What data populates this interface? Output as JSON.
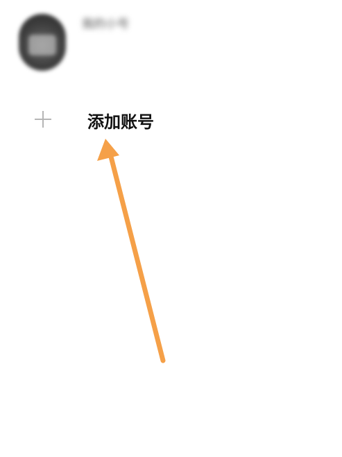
{
  "account": {
    "name": "我的小号",
    "subtitle": "",
    "detail": "",
    "current_badge": ""
  },
  "add_account": {
    "label": "添加账号"
  },
  "annotation": {
    "arrow_color": "#F5A048"
  }
}
